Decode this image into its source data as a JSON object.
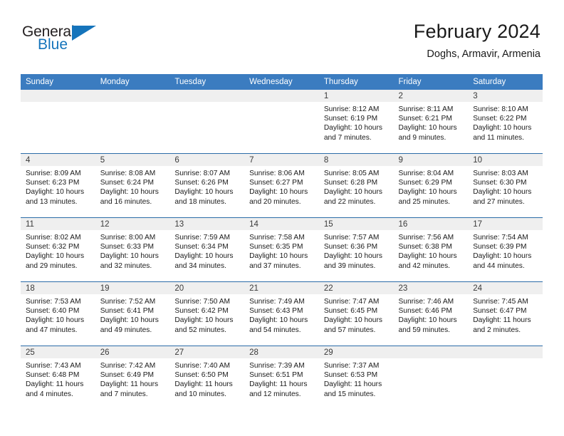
{
  "brand": {
    "name_part1": "General",
    "name_part2": "Blue",
    "logo_icon": "triangle-logo-icon"
  },
  "header": {
    "title": "February 2024",
    "subtitle": "Doghs, Armavir, Armenia"
  },
  "colors": {
    "header_blue": "#3b7cc0",
    "rule_blue": "#2b6ca8",
    "brand_blue": "#1574bb",
    "day_head_gray": "#efefef"
  },
  "weekday_headers": [
    "Sunday",
    "Monday",
    "Tuesday",
    "Wednesday",
    "Thursday",
    "Friday",
    "Saturday"
  ],
  "weeks": [
    [
      {
        "day": "",
        "sunrise": "",
        "sunset": "",
        "daylight1": "",
        "daylight2": ""
      },
      {
        "day": "",
        "sunrise": "",
        "sunset": "",
        "daylight1": "",
        "daylight2": ""
      },
      {
        "day": "",
        "sunrise": "",
        "sunset": "",
        "daylight1": "",
        "daylight2": ""
      },
      {
        "day": "",
        "sunrise": "",
        "sunset": "",
        "daylight1": "",
        "daylight2": ""
      },
      {
        "day": "1",
        "sunrise": "Sunrise: 8:12 AM",
        "sunset": "Sunset: 6:19 PM",
        "daylight1": "Daylight: 10 hours",
        "daylight2": "and 7 minutes."
      },
      {
        "day": "2",
        "sunrise": "Sunrise: 8:11 AM",
        "sunset": "Sunset: 6:21 PM",
        "daylight1": "Daylight: 10 hours",
        "daylight2": "and 9 minutes."
      },
      {
        "day": "3",
        "sunrise": "Sunrise: 8:10 AM",
        "sunset": "Sunset: 6:22 PM",
        "daylight1": "Daylight: 10 hours",
        "daylight2": "and 11 minutes."
      }
    ],
    [
      {
        "day": "4",
        "sunrise": "Sunrise: 8:09 AM",
        "sunset": "Sunset: 6:23 PM",
        "daylight1": "Daylight: 10 hours",
        "daylight2": "and 13 minutes."
      },
      {
        "day": "5",
        "sunrise": "Sunrise: 8:08 AM",
        "sunset": "Sunset: 6:24 PM",
        "daylight1": "Daylight: 10 hours",
        "daylight2": "and 16 minutes."
      },
      {
        "day": "6",
        "sunrise": "Sunrise: 8:07 AM",
        "sunset": "Sunset: 6:26 PM",
        "daylight1": "Daylight: 10 hours",
        "daylight2": "and 18 minutes."
      },
      {
        "day": "7",
        "sunrise": "Sunrise: 8:06 AM",
        "sunset": "Sunset: 6:27 PM",
        "daylight1": "Daylight: 10 hours",
        "daylight2": "and 20 minutes."
      },
      {
        "day": "8",
        "sunrise": "Sunrise: 8:05 AM",
        "sunset": "Sunset: 6:28 PM",
        "daylight1": "Daylight: 10 hours",
        "daylight2": "and 22 minutes."
      },
      {
        "day": "9",
        "sunrise": "Sunrise: 8:04 AM",
        "sunset": "Sunset: 6:29 PM",
        "daylight1": "Daylight: 10 hours",
        "daylight2": "and 25 minutes."
      },
      {
        "day": "10",
        "sunrise": "Sunrise: 8:03 AM",
        "sunset": "Sunset: 6:30 PM",
        "daylight1": "Daylight: 10 hours",
        "daylight2": "and 27 minutes."
      }
    ],
    [
      {
        "day": "11",
        "sunrise": "Sunrise: 8:02 AM",
        "sunset": "Sunset: 6:32 PM",
        "daylight1": "Daylight: 10 hours",
        "daylight2": "and 29 minutes."
      },
      {
        "day": "12",
        "sunrise": "Sunrise: 8:00 AM",
        "sunset": "Sunset: 6:33 PM",
        "daylight1": "Daylight: 10 hours",
        "daylight2": "and 32 minutes."
      },
      {
        "day": "13",
        "sunrise": "Sunrise: 7:59 AM",
        "sunset": "Sunset: 6:34 PM",
        "daylight1": "Daylight: 10 hours",
        "daylight2": "and 34 minutes."
      },
      {
        "day": "14",
        "sunrise": "Sunrise: 7:58 AM",
        "sunset": "Sunset: 6:35 PM",
        "daylight1": "Daylight: 10 hours",
        "daylight2": "and 37 minutes."
      },
      {
        "day": "15",
        "sunrise": "Sunrise: 7:57 AM",
        "sunset": "Sunset: 6:36 PM",
        "daylight1": "Daylight: 10 hours",
        "daylight2": "and 39 minutes."
      },
      {
        "day": "16",
        "sunrise": "Sunrise: 7:56 AM",
        "sunset": "Sunset: 6:38 PM",
        "daylight1": "Daylight: 10 hours",
        "daylight2": "and 42 minutes."
      },
      {
        "day": "17",
        "sunrise": "Sunrise: 7:54 AM",
        "sunset": "Sunset: 6:39 PM",
        "daylight1": "Daylight: 10 hours",
        "daylight2": "and 44 minutes."
      }
    ],
    [
      {
        "day": "18",
        "sunrise": "Sunrise: 7:53 AM",
        "sunset": "Sunset: 6:40 PM",
        "daylight1": "Daylight: 10 hours",
        "daylight2": "and 47 minutes."
      },
      {
        "day": "19",
        "sunrise": "Sunrise: 7:52 AM",
        "sunset": "Sunset: 6:41 PM",
        "daylight1": "Daylight: 10 hours",
        "daylight2": "and 49 minutes."
      },
      {
        "day": "20",
        "sunrise": "Sunrise: 7:50 AM",
        "sunset": "Sunset: 6:42 PM",
        "daylight1": "Daylight: 10 hours",
        "daylight2": "and 52 minutes."
      },
      {
        "day": "21",
        "sunrise": "Sunrise: 7:49 AM",
        "sunset": "Sunset: 6:43 PM",
        "daylight1": "Daylight: 10 hours",
        "daylight2": "and 54 minutes."
      },
      {
        "day": "22",
        "sunrise": "Sunrise: 7:47 AM",
        "sunset": "Sunset: 6:45 PM",
        "daylight1": "Daylight: 10 hours",
        "daylight2": "and 57 minutes."
      },
      {
        "day": "23",
        "sunrise": "Sunrise: 7:46 AM",
        "sunset": "Sunset: 6:46 PM",
        "daylight1": "Daylight: 10 hours",
        "daylight2": "and 59 minutes."
      },
      {
        "day": "24",
        "sunrise": "Sunrise: 7:45 AM",
        "sunset": "Sunset: 6:47 PM",
        "daylight1": "Daylight: 11 hours",
        "daylight2": "and 2 minutes."
      }
    ],
    [
      {
        "day": "25",
        "sunrise": "Sunrise: 7:43 AM",
        "sunset": "Sunset: 6:48 PM",
        "daylight1": "Daylight: 11 hours",
        "daylight2": "and 4 minutes."
      },
      {
        "day": "26",
        "sunrise": "Sunrise: 7:42 AM",
        "sunset": "Sunset: 6:49 PM",
        "daylight1": "Daylight: 11 hours",
        "daylight2": "and 7 minutes."
      },
      {
        "day": "27",
        "sunrise": "Sunrise: 7:40 AM",
        "sunset": "Sunset: 6:50 PM",
        "daylight1": "Daylight: 11 hours",
        "daylight2": "and 10 minutes."
      },
      {
        "day": "28",
        "sunrise": "Sunrise: 7:39 AM",
        "sunset": "Sunset: 6:51 PM",
        "daylight1": "Daylight: 11 hours",
        "daylight2": "and 12 minutes."
      },
      {
        "day": "29",
        "sunrise": "Sunrise: 7:37 AM",
        "sunset": "Sunset: 6:53 PM",
        "daylight1": "Daylight: 11 hours",
        "daylight2": "and 15 minutes."
      },
      {
        "day": "",
        "sunrise": "",
        "sunset": "",
        "daylight1": "",
        "daylight2": ""
      },
      {
        "day": "",
        "sunrise": "",
        "sunset": "",
        "daylight1": "",
        "daylight2": ""
      }
    ]
  ]
}
